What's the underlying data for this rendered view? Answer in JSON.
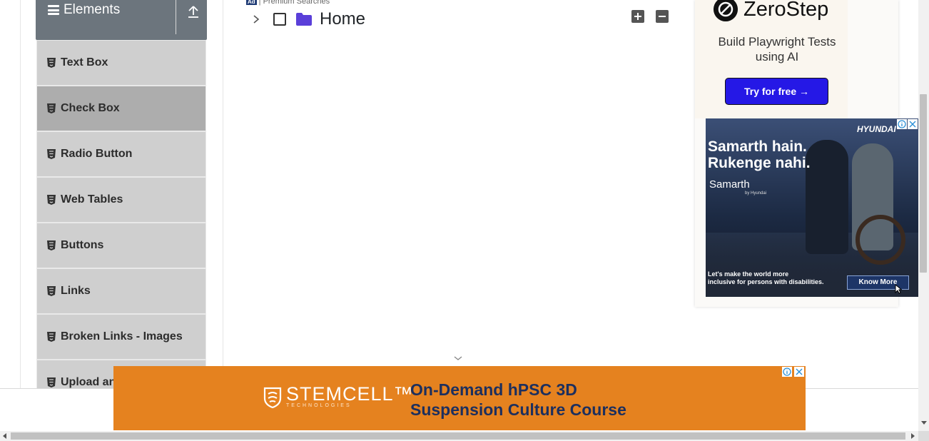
{
  "sidebar": {
    "group_title": "Elements",
    "group_icon": "hamburger-icon",
    "collapse_icon": "upload-arrow-icon",
    "items": [
      {
        "label": "Text Box",
        "active": false
      },
      {
        "label": "Check Box",
        "active": true
      },
      {
        "label": "Radio Button",
        "active": false
      },
      {
        "label": "Web Tables",
        "active": false
      },
      {
        "label": "Buttons",
        "active": false
      },
      {
        "label": "Links",
        "active": false
      },
      {
        "label": "Broken Links - Images",
        "active": false
      },
      {
        "label": "Upload an",
        "active": false
      }
    ],
    "item_icon": "html5-icon"
  },
  "main": {
    "ad_tag": {
      "badge": "Ad",
      "text": "| Premium Searches"
    },
    "tree": {
      "root_label": "Home",
      "checked": false,
      "expand_all_icon": "plus-icon",
      "collapse_all_icon": "minus-icon"
    }
  },
  "ads": {
    "zerostep": {
      "brand": "ZeroStep",
      "tagline": "Build Playwright Tests using AI",
      "cta": "Try for free →"
    },
    "hyundai": {
      "brand": "HYUNDAI",
      "headline_1": "Samarth hain.",
      "headline_2": "Rukenge nahi.",
      "sub": "Samarth",
      "sub_small": "by Hyundai",
      "footer_1": "Let's make the world more",
      "footer_2": "inclusive for persons with disabilities.",
      "cta": "Know More"
    },
    "stemcell": {
      "brand": "STEMCELL™",
      "brand_sub": "TECHNOLOGIES",
      "headline_1": "On-Demand hPSC 3D",
      "headline_2": "Suspension Culture Course"
    }
  },
  "colors": {
    "sidebar_header": "#6c757d",
    "menu_item": "#cfcfcf",
    "menu_item_active": "#adadad",
    "folder": "#5a3fd9",
    "zerostep_cta": "#2518e6",
    "stemcell_bg": "#e5821f",
    "stemcell_text": "#1c2f5e"
  }
}
